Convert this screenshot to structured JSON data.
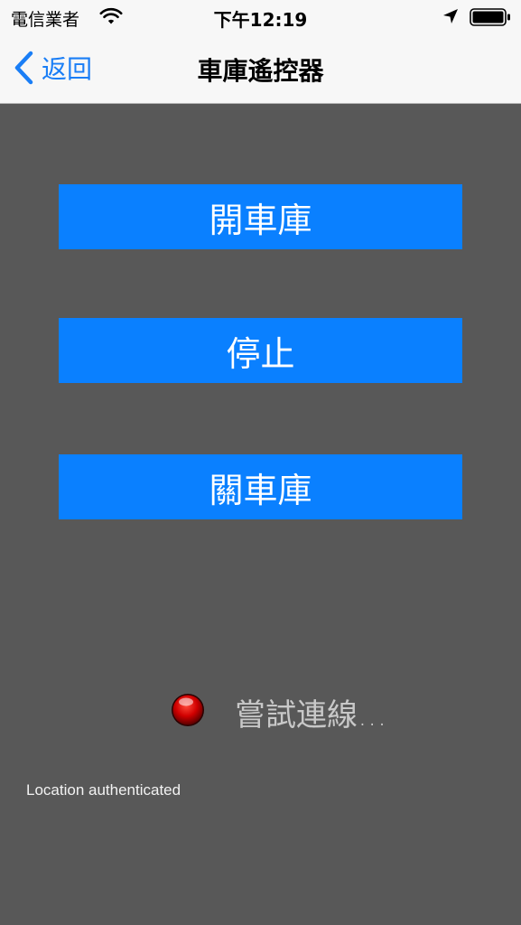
{
  "status_bar": {
    "carrier": "電信業者",
    "time": "下午12:19"
  },
  "nav": {
    "back_label": "返回",
    "title": "車庫遙控器"
  },
  "buttons": {
    "open": "開車庫",
    "stop": "停止",
    "close": "關車庫"
  },
  "connection": {
    "status_text": "嘗試連線...",
    "led_color": "#e00000"
  },
  "location_status": "Location authenticated",
  "colors": {
    "accent": "#0a80ff",
    "background": "#585858",
    "nav_tint": "#1a7ef6"
  }
}
